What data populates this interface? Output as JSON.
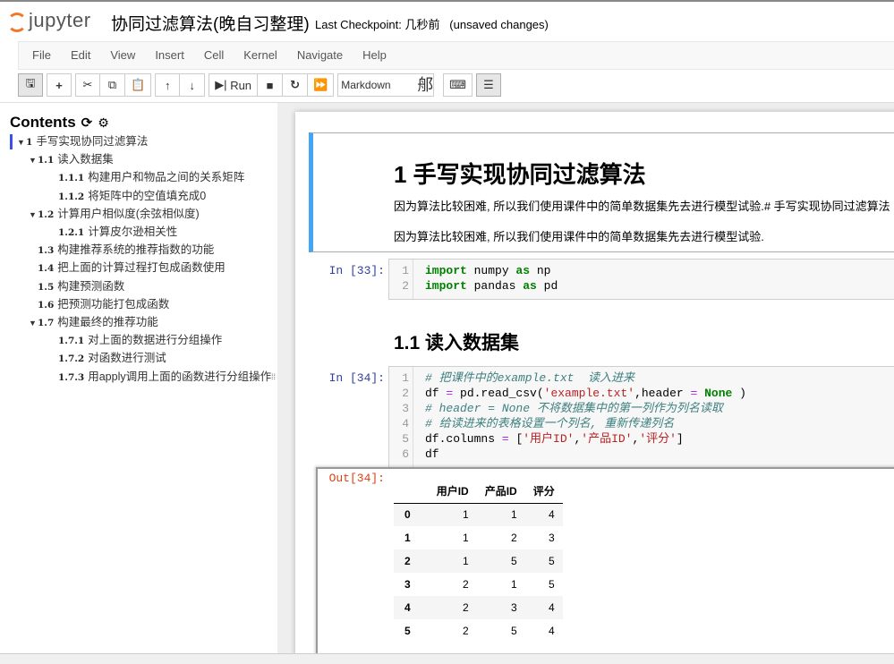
{
  "header": {
    "logo_text": "jupyter",
    "title": "协同过滤算法(晚自习整理)",
    "checkpoint": "Last Checkpoint: 几秒前",
    "unsaved": "(unsaved changes)"
  },
  "menu": [
    "File",
    "Edit",
    "View",
    "Insert",
    "Cell",
    "Kernel",
    "Navigate",
    "Help"
  ],
  "toolbar": {
    "run_label": "Run",
    "cell_type": "Markdown",
    "cell_type_glyph": "郍"
  },
  "toc": {
    "title": "Contents",
    "items": [
      {
        "num": "1",
        "label": "手写实现协同过滤算法",
        "level": 0,
        "tri": true,
        "sel": true
      },
      {
        "num": "1.1",
        "label": "读入数据集",
        "level": 1,
        "tri": true
      },
      {
        "num": "1.1.1",
        "label": "构建用户和物品之间的关系矩阵",
        "level": 2
      },
      {
        "num": "1.1.2",
        "label": "将矩阵中的空值填充成0",
        "level": 2
      },
      {
        "num": "1.2",
        "label": "计算用户相似度(余弦相似度)",
        "level": 1,
        "tri": true
      },
      {
        "num": "1.2.1",
        "label": "计算皮尔逊相关性",
        "level": 2
      },
      {
        "num": "1.3",
        "label": "构建推荐系统的推荐指数的功能",
        "level": 1
      },
      {
        "num": "1.4",
        "label": "把上面的计算过程打包成函数使用",
        "level": 1
      },
      {
        "num": "1.5",
        "label": "构建预测函数",
        "level": 1
      },
      {
        "num": "1.6",
        "label": "把预测功能打包成函数",
        "level": 1
      },
      {
        "num": "1.7",
        "label": "构建最终的推荐功能",
        "level": 1,
        "tri": true
      },
      {
        "num": "1.7.1",
        "label": "对上面的数据进行分组操作",
        "level": 2
      },
      {
        "num": "1.7.2",
        "label": "对函数进行测试",
        "level": 2
      },
      {
        "num": "1.7.3",
        "label": "用apply调用上面的函数进行分组操作",
        "level": 2
      }
    ]
  },
  "notebook": {
    "md": {
      "heading": "1  手写实现协同过滤算法",
      "p1": "因为算法比较困难, 所以我们使用课件中的简单数据集先去进行模型试验.# 手写实现协同过滤算法",
      "p2": "因为算法比较困难, 所以我们使用课件中的简单数据集先去进行模型试验."
    },
    "cell33": {
      "prompt": "In [33]:",
      "lines": [
        [
          [
            "import",
            "kw"
          ],
          [
            " numpy ",
            ""
          ],
          [
            "as",
            "kw"
          ],
          [
            " np",
            ""
          ]
        ],
        [
          [
            "import",
            "kw"
          ],
          [
            " pandas ",
            ""
          ],
          [
            "as",
            "kw"
          ],
          [
            " pd",
            ""
          ]
        ]
      ]
    },
    "h11": "1.1  读入数据集",
    "cell34": {
      "prompt": "In [34]:",
      "lines": [
        [
          [
            "# 把课件中的example.txt  读入进来",
            "cm"
          ]
        ],
        [
          [
            "df ",
            ""
          ],
          [
            "=",
            "op"
          ],
          [
            " pd.read_csv(",
            ""
          ],
          [
            "'example.txt'",
            "st"
          ],
          [
            ",header ",
            ""
          ],
          [
            "=",
            "op"
          ],
          [
            " ",
            ""
          ],
          [
            "None",
            "kw"
          ],
          [
            " )",
            ""
          ]
        ],
        [
          [
            "# header = None 不将数据集中的第一列作为列名读取",
            "cm"
          ]
        ],
        [
          [
            "# 给读进来的表格设置一个列名, 重新传递列名",
            "cm"
          ]
        ],
        [
          [
            "df.columns ",
            ""
          ],
          [
            "=",
            "op"
          ],
          [
            " [",
            ""
          ],
          [
            "'用户ID'",
            "st"
          ],
          [
            ",",
            ""
          ],
          [
            "'产品ID'",
            "st"
          ],
          [
            ",",
            ""
          ],
          [
            "'评分'",
            "st"
          ],
          [
            "]",
            ""
          ]
        ],
        [
          [
            "df",
            ""
          ]
        ]
      ]
    },
    "out34": {
      "prompt": "Out[34]:",
      "columns": [
        "",
        "用户ID",
        "产品ID",
        "评分"
      ],
      "rows": [
        [
          "0",
          "1",
          "1",
          "4"
        ],
        [
          "1",
          "1",
          "2",
          "3"
        ],
        [
          "2",
          "1",
          "5",
          "5"
        ],
        [
          "3",
          "2",
          "1",
          "5"
        ],
        [
          "4",
          "2",
          "3",
          "4"
        ],
        [
          "5",
          "2",
          "5",
          "4"
        ]
      ]
    }
  }
}
